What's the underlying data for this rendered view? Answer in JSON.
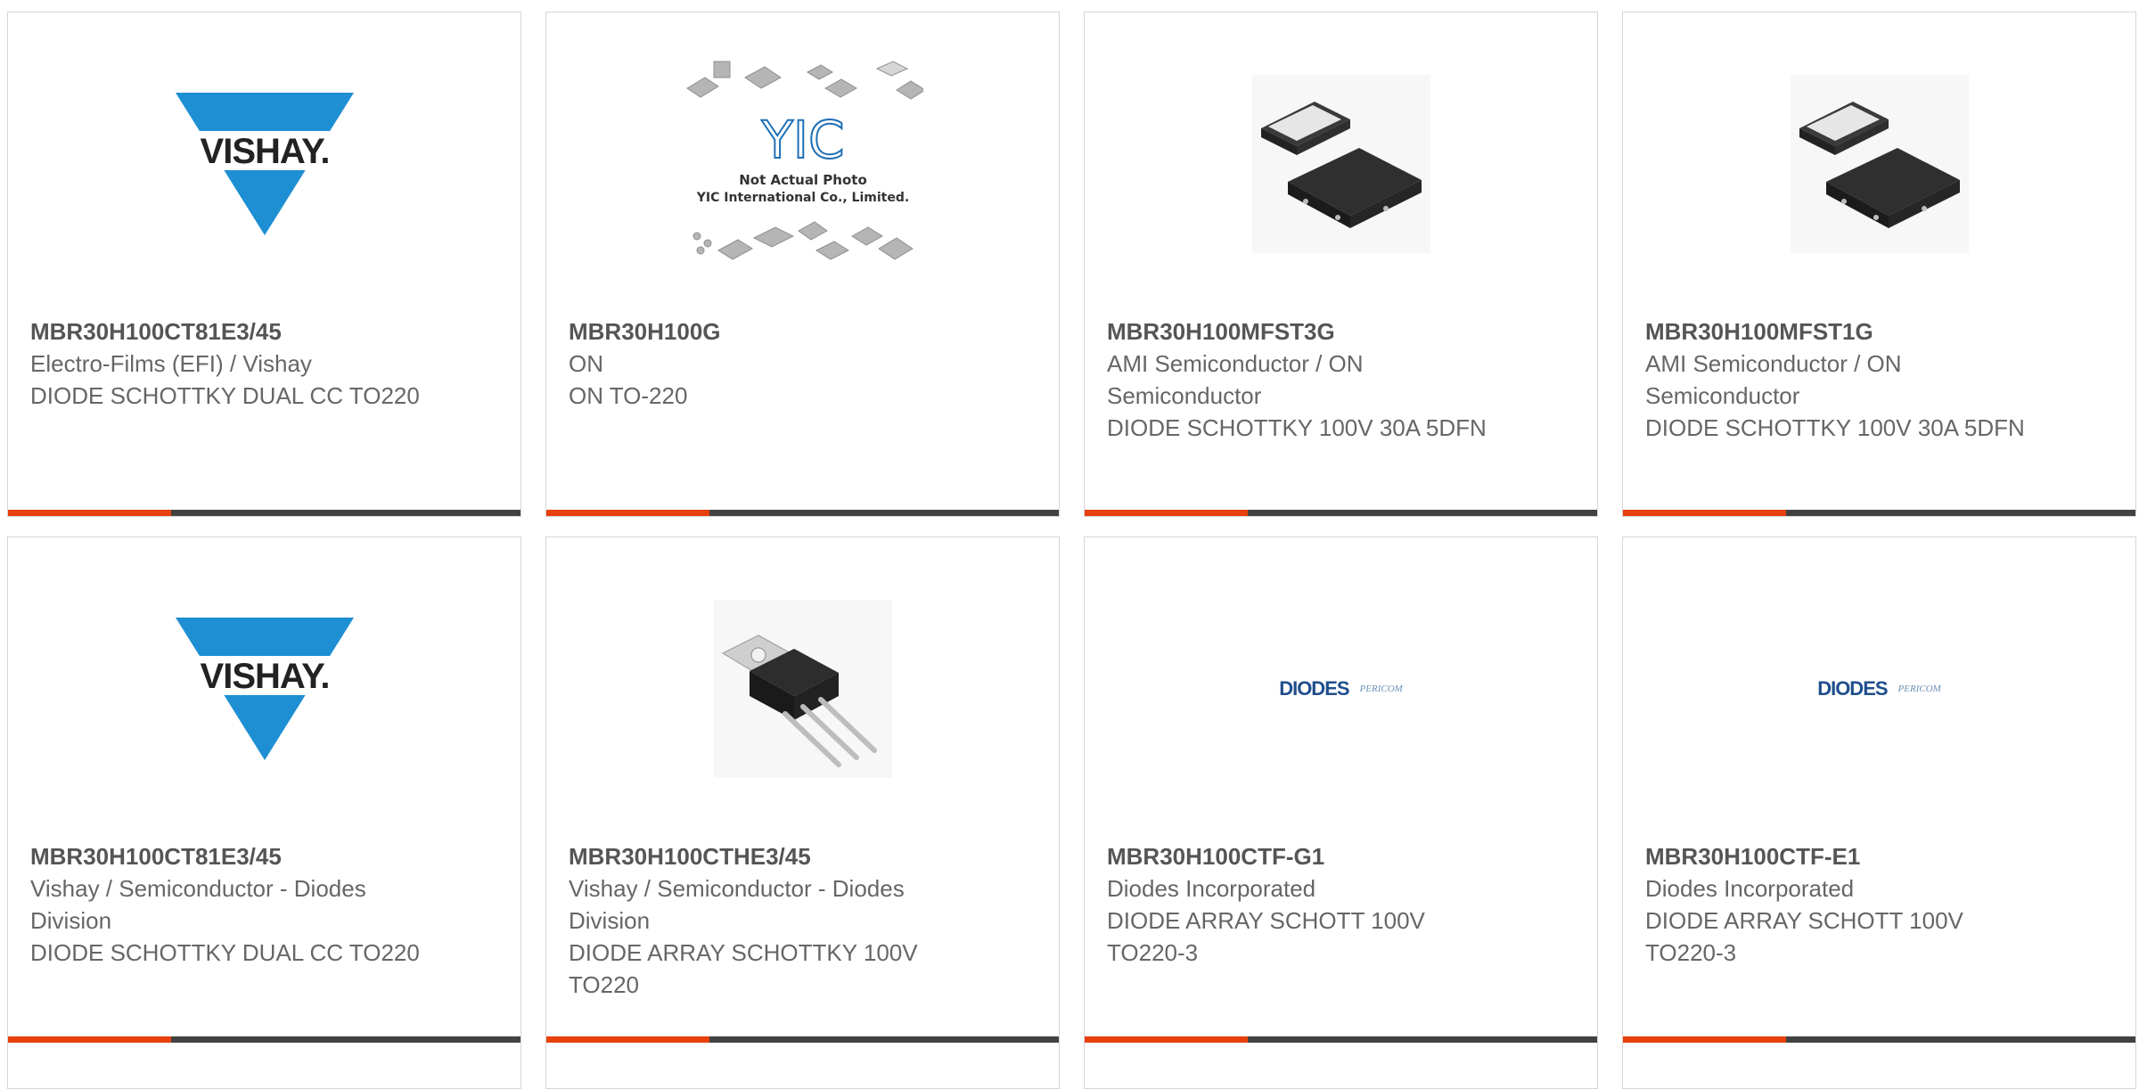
{
  "products": [
    {
      "part_number": "MBR30H100CT81E3/45",
      "manufacturer": "Electro-Films (EFI) / Vishay",
      "description": "DIODE SCHOTTKY DUAL CC TO220",
      "image": "vishay-logo",
      "logo_text": "VISHAY."
    },
    {
      "part_number": "MBR30H100G",
      "manufacturer": "ON",
      "description": "ON TO-220",
      "image": "yic-placeholder",
      "logo_text": "YIC",
      "caption_line1": "Not Actual Photo",
      "caption_line2": "YIC International Co., Limited."
    },
    {
      "part_number": "MBR30H100MFST3G",
      "manufacturer": "AMI Semiconductor / ON Semiconductor",
      "description": "DIODE SCHOTTKY 100V 30A 5DFN",
      "image": "dfn-package-photo"
    },
    {
      "part_number": "MBR30H100MFST1G",
      "manufacturer": "AMI Semiconductor / ON Semiconductor",
      "description": "DIODE SCHOTTKY 100V 30A 5DFN",
      "image": "dfn-package-photo"
    },
    {
      "part_number": "MBR30H100CT81E3/45",
      "manufacturer": "Vishay / Semiconductor - Diodes Division",
      "description": "DIODE SCHOTTKY DUAL CC TO220",
      "image": "vishay-logo",
      "logo_text": "VISHAY."
    },
    {
      "part_number": "MBR30H100CTHE3/45",
      "manufacturer": "Vishay / Semiconductor - Diodes Division",
      "description": "DIODE ARRAY SCHOTTKY 100V TO220",
      "image": "to220-package-photo"
    },
    {
      "part_number": "MBR30H100CTF-G1",
      "manufacturer": "Diodes Incorporated",
      "description": "DIODE ARRAY SCHOTT 100V TO220-3",
      "image": "diodes-pericom-logo",
      "logo_text": "DIODES",
      "logo_text_2": "PERICOM"
    },
    {
      "part_number": "MBR30H100CTF-E1",
      "manufacturer": "Diodes Incorporated",
      "description": "DIODE ARRAY SCHOTT 100V TO220-3",
      "image": "diodes-pericom-logo",
      "logo_text": "DIODES",
      "logo_text_2": "PERICOM"
    }
  ],
  "colors": {
    "accent": "#e8400c",
    "bar": "#424242",
    "text": "#666666",
    "part_number": "#555555",
    "card_border": "#d6d6d6",
    "vishay_blue": "#1e8fd2",
    "diodes_blue": "#1f4e8c"
  }
}
